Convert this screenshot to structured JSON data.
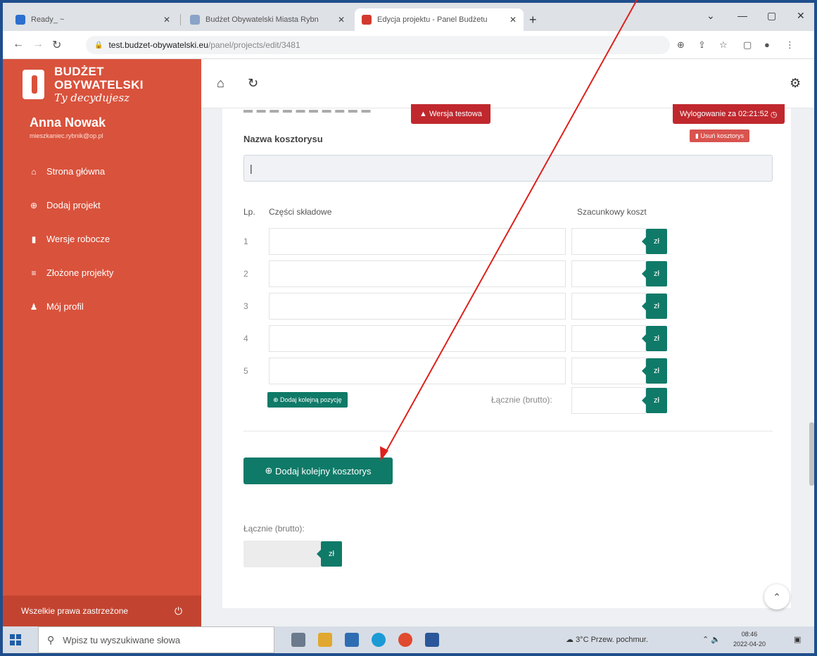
{
  "browser": {
    "tabs": [
      {
        "label": "Ready_ ~",
        "active": false
      },
      {
        "label": "Budżet Obywatelski Miasta Rybn",
        "active": false
      },
      {
        "label": "Edycja projektu - Panel Budżetu",
        "active": true
      }
    ],
    "url_host": "test.budzet-obywatelski.eu",
    "url_path": "/panel/projects/edit/3481"
  },
  "sidebar": {
    "brand_title": "BUDŻET OBYWATELSKI",
    "brand_subtitle": "Ty decydujesz",
    "user_name": "Anna Nowak",
    "user_email": "mieszkaniec.rybnik@op.pl",
    "nav": [
      {
        "label": "Strona główna",
        "icon": "home-icon"
      },
      {
        "label": "Dodaj projekt",
        "icon": "plus-circle-icon"
      },
      {
        "label": "Wersje robocze",
        "icon": "file-icon"
      },
      {
        "label": "Złożone projekty",
        "icon": "list-icon"
      },
      {
        "label": "Mój profil",
        "icon": "user-icon"
      }
    ],
    "footer": "Wszelkie prawa zastrzeżone"
  },
  "banner": {
    "test_version": "Wersja testowa",
    "logout_timer": "Wylogowanie za 02:21:52"
  },
  "estimate": {
    "section_label": "Nazwa kosztorysu",
    "name_value": "|",
    "delete_label": "Usuń kosztorys",
    "col_lp": "Lp.",
    "col_parts": "Części składowe",
    "col_cost": "Szacunkowy koszt",
    "rows": [
      "1",
      "2",
      "3",
      "4",
      "5"
    ],
    "currency": "zł",
    "add_position": "Dodaj kolejną pozycję",
    "subtotal_label": "Łącznie (brutto):"
  },
  "add_estimate_label": "Dodaj kolejny kosztorys",
  "total_label": "Łącznie (brutto):",
  "taskbar": {
    "search_placeholder": "Wpisz tu wyszukiwane słowa",
    "weather": "3°C Przew. pochmur.",
    "time": "08:46",
    "date": "2022-04-20"
  },
  "colors": {
    "sidebar": "#d9523c",
    "accent": "#0f7a68",
    "danger": "#c0282e",
    "annotation": "#e0201c"
  }
}
